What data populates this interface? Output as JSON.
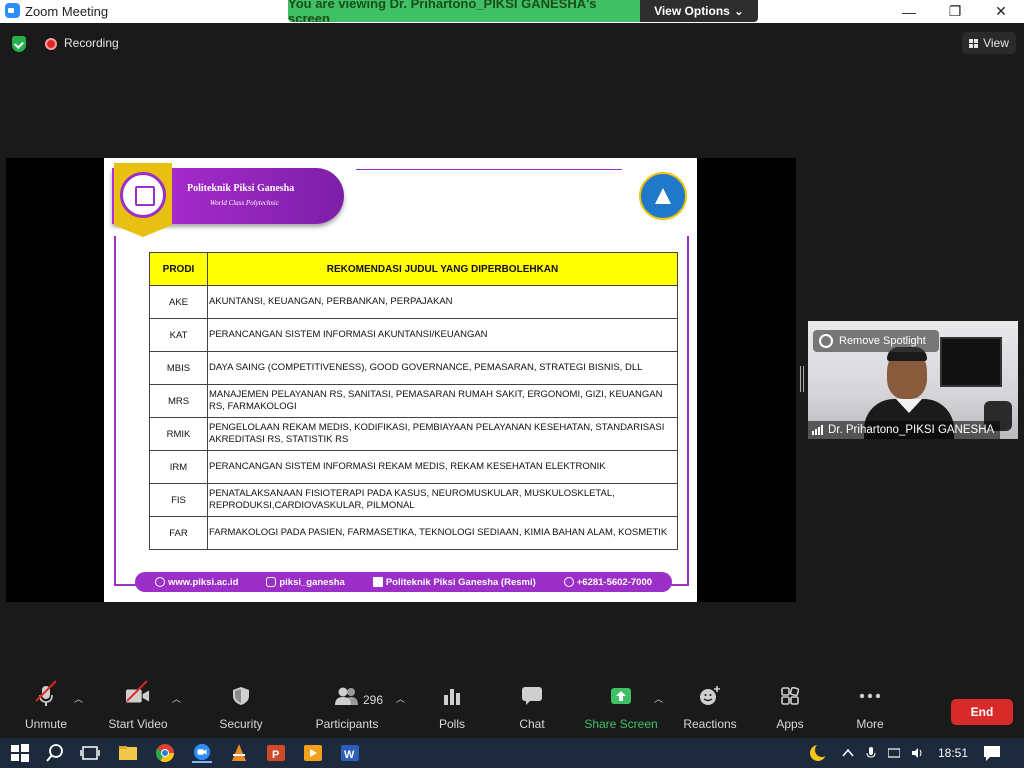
{
  "window": {
    "title": "Zoom Meeting",
    "viewing_banner": "You are viewing Dr. Prihartono_PIKSI GANESHA's screen",
    "view_options": "View Options",
    "controls": {
      "minimize": "—",
      "maximize": "❐",
      "close": "✕"
    }
  },
  "top": {
    "recording_label": "Recording",
    "view_label": "View"
  },
  "slide": {
    "header_title": "Politeknik Piksi Ganesha",
    "header_subtitle": "World Class Polytechnic",
    "table": {
      "headers": [
        "PRODI",
        "REKOMENDASI JUDUL YANG DIPERBOLEHKAN"
      ],
      "rows": [
        {
          "code": "AKE",
          "topic": "AKUNTANSI, KEUANGAN, PERBANKAN, PERPAJAKAN"
        },
        {
          "code": "KAT",
          "topic": "PERANCANGAN SISTEM INFORMASI AKUNTANSI/KEUANGAN"
        },
        {
          "code": "MBIS",
          "topic": "DAYA SAING (COMPETITIVENESS),  GOOD GOVERNANCE, PEMASARAN, STRATEGI BISNIS, DLL"
        },
        {
          "code": "MRS",
          "topic": "MANAJEMEN PELAYANAN RS, SANITASI, PEMASARAN RUMAH SAKIT, ERGONOMI, GIZI, KEUANGAN RS, FARMAKOLOGI"
        },
        {
          "code": "RMIK",
          "topic": "PENGELOLAAN REKAM MEDIS, KODIFIKASI, PEMBIAYAAN PELAYANAN KESEHATAN, STANDARISASI AKREDITASI RS, STATISTIK RS"
        },
        {
          "code": "IRM",
          "topic": "PERANCANGAN SISTEM INFORMASI REKAM MEDIS, REKAM KESEHATAN ELEKTRONIK"
        },
        {
          "code": "FIS",
          "topic": "PENATALAKSANAAN FISIOTERAPI PADA KASUS, NEUROMUSKULAR, MUSKULOSKLETAL, REPRODUKSI,CARDIOVASKULAR, PILMONAL"
        },
        {
          "code": "FAR",
          "topic": "FARMAKOLOGI PADA PASIEN, FARMASETIKA, TEKNOLOGI SEDIAAN, KIMIA BAHAN ALAM, KOSMETIK"
        }
      ]
    },
    "footer": {
      "website": "www.piksi.ac.id",
      "instagram": "piksi_ganesha",
      "facebook": "Politeknik Piksi Ganesha (Resmi)",
      "whatsapp": "+6281-5602-7000"
    }
  },
  "video": {
    "remove_spotlight": "Remove Spotlight",
    "participant_name": "Dr. Prihartono_PIKSI GANESHA"
  },
  "toolbar": {
    "unmute": "Unmute",
    "start_video": "Start Video",
    "security": "Security",
    "participants": "Participants",
    "participants_count": "296",
    "polls": "Polls",
    "chat": "Chat",
    "share_screen": "Share Screen",
    "reactions": "Reactions",
    "apps": "Apps",
    "more": "More",
    "end": "End"
  },
  "taskbar": {
    "clock": "18:51"
  },
  "colors": {
    "accent_purple": "#9b2fc8",
    "table_header_yellow": "#ffff00",
    "banner_green": "#3fc065",
    "end_red": "#d92a2a"
  }
}
